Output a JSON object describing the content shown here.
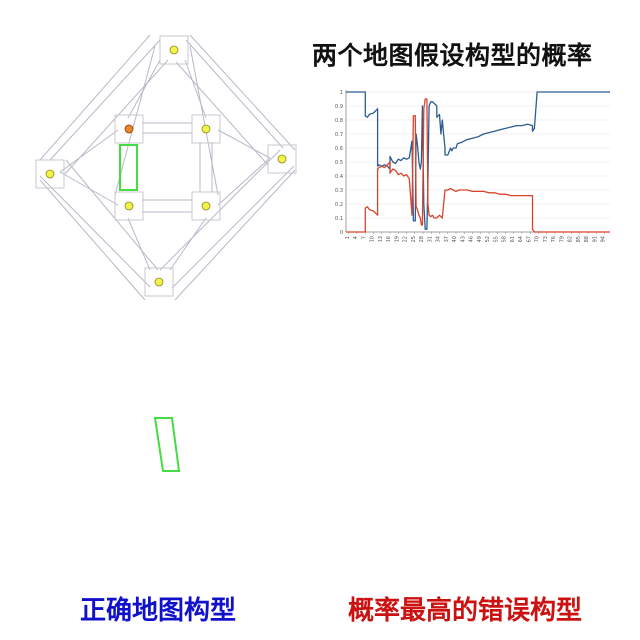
{
  "title": "两个地图假设构型的概率",
  "caption_left": "正确地图构型",
  "caption_right": "概率最高的错误构型",
  "colors": {
    "title": "#111111",
    "caption_left": "#1111cc",
    "caption_right": "#cc1111",
    "series_blue": "#2a5d94",
    "series_red": "#d9432b",
    "map_lines": "#b8b8c8",
    "highlight": "#44dd44",
    "landmark_yellow": "#f2f24a",
    "landmark_orange": "#e8882a"
  },
  "chart_data": {
    "type": "line",
    "title": "",
    "xlabel": "",
    "ylabel": "",
    "ylim": [
      0,
      1
    ],
    "y_ticks": [
      "0",
      "0.1",
      "0.2",
      "0.3",
      "0.4",
      "0.5",
      "0.6",
      "0.7",
      "0.8",
      "0.9",
      "1"
    ],
    "x_ticks": [
      "1",
      "4",
      "7",
      "10",
      "13",
      "16",
      "19",
      "22",
      "25",
      "28",
      "31",
      "34",
      "37",
      "40",
      "43",
      "46",
      "49",
      "52",
      "55",
      "58",
      "61",
      "64",
      "67",
      "70",
      "73",
      "76",
      "79",
      "82",
      "85",
      "88",
      "91",
      "94"
    ],
    "xlim": [
      0,
      96
    ],
    "grid": true,
    "series": [
      {
        "color": "blue",
        "points": [
          [
            0,
            1
          ],
          [
            7,
            1
          ],
          [
            7,
            0.83
          ],
          [
            7.8,
            0.82
          ],
          [
            8.5,
            0.84
          ],
          [
            10,
            0.85
          ],
          [
            11.5,
            0.88
          ],
          [
            11.5,
            0.47
          ],
          [
            12,
            0.48
          ],
          [
            13,
            0.47
          ],
          [
            14,
            0.48
          ],
          [
            15,
            0.47
          ],
          [
            16,
            0.45
          ],
          [
            16,
            0.54
          ],
          [
            17,
            0.5
          ],
          [
            18,
            0.49
          ],
          [
            19,
            0.52
          ],
          [
            20,
            0.51
          ],
          [
            21,
            0.53
          ],
          [
            22,
            0.52
          ],
          [
            23,
            0.53
          ],
          [
            24,
            0.65
          ],
          [
            24.5,
            0.08
          ],
          [
            25.2,
            0.08
          ],
          [
            25.5,
            0.7
          ],
          [
            26,
            0.62
          ],
          [
            26.5,
            0.5
          ],
          [
            27,
            0.45
          ],
          [
            27.4,
            0.5
          ],
          [
            27.8,
            0.9
          ],
          [
            28.3,
            0.2
          ],
          [
            28.8,
            0.02
          ],
          [
            29.4,
            0.02
          ],
          [
            29.8,
            0.35
          ],
          [
            30.2,
            0.9
          ],
          [
            30.8,
            0.93
          ],
          [
            31.5,
            0.93
          ],
          [
            32,
            0.92
          ],
          [
            33,
            0.9
          ],
          [
            33,
            0.82
          ],
          [
            34,
            0.84
          ],
          [
            34.5,
            0.7
          ],
          [
            35,
            0.8
          ],
          [
            35.5,
            0.7
          ],
          [
            36,
            0.6
          ],
          [
            36,
            0.55
          ],
          [
            37,
            0.55
          ],
          [
            38,
            0.6
          ],
          [
            38.5,
            0.58
          ],
          [
            39,
            0.6
          ],
          [
            40,
            0.6
          ],
          [
            40.5,
            0.63
          ],
          [
            42,
            0.64
          ],
          [
            44,
            0.66
          ],
          [
            46,
            0.67
          ],
          [
            48,
            0.68
          ],
          [
            50,
            0.7
          ],
          [
            52,
            0.71
          ],
          [
            54,
            0.72
          ],
          [
            56,
            0.73
          ],
          [
            58,
            0.74
          ],
          [
            60,
            0.75
          ],
          [
            62,
            0.76
          ],
          [
            64,
            0.76
          ],
          [
            66,
            0.77
          ],
          [
            67.8,
            0.76
          ],
          [
            67.8,
            0.72
          ],
          [
            68.5,
            0.74
          ],
          [
            69.5,
            1
          ],
          [
            96,
            1
          ]
        ]
      },
      {
        "color": "red",
        "points": [
          [
            0,
            0
          ],
          [
            7,
            0
          ],
          [
            7,
            0.17
          ],
          [
            7.8,
            0.18
          ],
          [
            8.5,
            0.16
          ],
          [
            10,
            0.15
          ],
          [
            11.5,
            0.12
          ],
          [
            11.5,
            0.45
          ],
          [
            12,
            0.46
          ],
          [
            13,
            0.47
          ],
          [
            14,
            0.46
          ],
          [
            15,
            0.48
          ],
          [
            16,
            0.5
          ],
          [
            16,
            0.42
          ],
          [
            17,
            0.45
          ],
          [
            18,
            0.44
          ],
          [
            19,
            0.41
          ],
          [
            20,
            0.42
          ],
          [
            21,
            0.4
          ],
          [
            22,
            0.41
          ],
          [
            23,
            0.38
          ],
          [
            24,
            0.12
          ],
          [
            24.5,
            0.83
          ],
          [
            25.2,
            0.83
          ],
          [
            25.5,
            0.18
          ],
          [
            26,
            0.16
          ],
          [
            26.5,
            0.12
          ],
          [
            27,
            0.1
          ],
          [
            27.4,
            0.05
          ],
          [
            27.8,
            0.05
          ],
          [
            28.3,
            0.88
          ],
          [
            28.8,
            0.95
          ],
          [
            29.4,
            0.95
          ],
          [
            29.8,
            0.2
          ],
          [
            30.2,
            0.12
          ],
          [
            30.8,
            0.11
          ],
          [
            31.5,
            0.12
          ],
          [
            32,
            0.1
          ],
          [
            33,
            0.1
          ],
          [
            34,
            0.12
          ],
          [
            35,
            0.1
          ],
          [
            36,
            0.3
          ],
          [
            37,
            0.3
          ],
          [
            38,
            0.31
          ],
          [
            39,
            0.3
          ],
          [
            40,
            0.29
          ],
          [
            41,
            0.3
          ],
          [
            42,
            0.3
          ],
          [
            44,
            0.3
          ],
          [
            46,
            0.29
          ],
          [
            48,
            0.29
          ],
          [
            50,
            0.29
          ],
          [
            52,
            0.28
          ],
          [
            54,
            0.28
          ],
          [
            56,
            0.27
          ],
          [
            58,
            0.27
          ],
          [
            60,
            0.26
          ],
          [
            62,
            0.26
          ],
          [
            64,
            0.26
          ],
          [
            66,
            0.26
          ],
          [
            67.8,
            0.26
          ],
          [
            67.8,
            0.02
          ],
          [
            68.5,
            0
          ],
          [
            96,
            0
          ]
        ]
      }
    ]
  }
}
